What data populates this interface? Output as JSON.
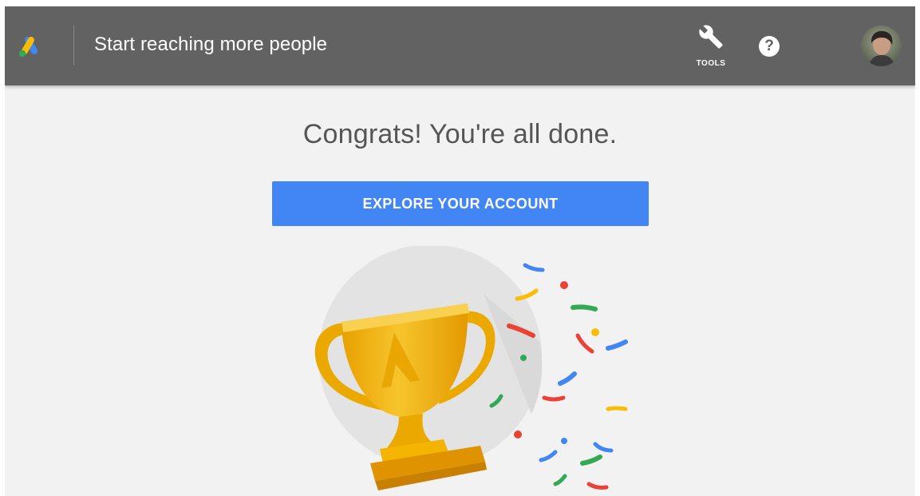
{
  "header": {
    "title": "Start reaching more people",
    "tools_label": "TOOLS",
    "help_symbol": "?"
  },
  "main": {
    "heading": "Congrats! You're all done.",
    "cta_label": "EXPLORE YOUR ACCOUNT"
  },
  "icons": {
    "logo": "google-ads-logo",
    "tools": "wrench-icon",
    "help": "help-icon",
    "avatar": "user-avatar",
    "illustration": "trophy-confetti-illustration"
  },
  "colors": {
    "header_bg": "#626262",
    "page_bg": "#f2f2f2",
    "primary_button": "#4285f4",
    "trophy_gold": "#f4b400",
    "confetti_blue": "#4285f4",
    "confetti_red": "#ea4335",
    "confetti_green": "#34a853",
    "confetti_yellow": "#fbbc04"
  }
}
